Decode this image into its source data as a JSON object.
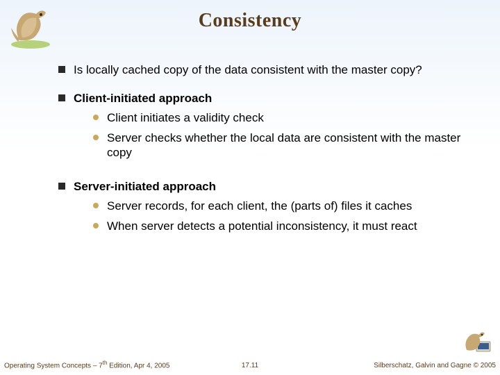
{
  "title": "Consistency",
  "bullets": [
    {
      "text": "Is locally cached copy of the data consistent with the master copy?",
      "bold": false,
      "sub": []
    },
    {
      "text": "Client-initiated approach",
      "bold": true,
      "sub": [
        "Client initiates a validity check",
        "Server checks whether the local data are consistent with the master copy"
      ]
    },
    {
      "text": "Server-initiated approach",
      "bold": true,
      "sub": [
        "Server records, for each client, the (parts of) files it caches",
        "When server detects a potential inconsistency, it must react"
      ]
    }
  ],
  "footer": {
    "left_pre": "Operating System Concepts – 7",
    "left_sup": "th",
    "left_post": " Edition, Apr 4, 2005",
    "center": "17.11",
    "right": "Silberschatz, Galvin and Gagne © 2005"
  }
}
